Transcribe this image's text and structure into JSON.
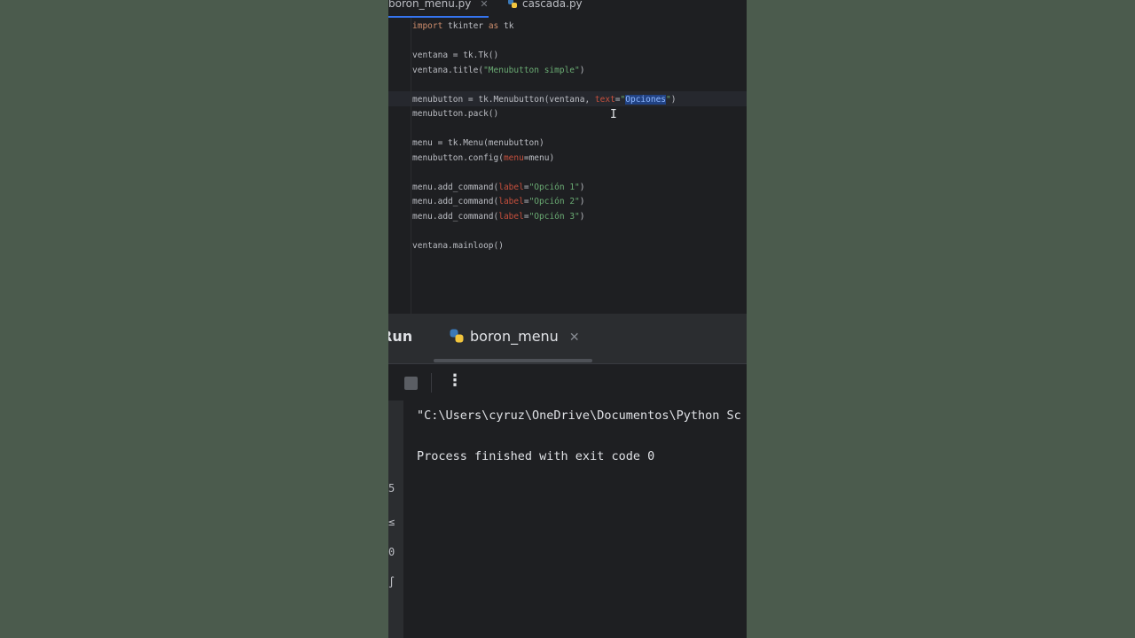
{
  "tabs": [
    {
      "label": "boron_menu.py",
      "active": true
    },
    {
      "label": "cascada.py",
      "active": false
    }
  ],
  "editor": {
    "lines": [
      [
        {
          "t": "import",
          "c": "kw"
        },
        {
          "t": " tkinter "
        },
        {
          "t": "as",
          "c": "kw"
        },
        {
          "t": " tk"
        }
      ],
      [],
      [
        {
          "t": "ventana = tk.Tk()"
        }
      ],
      [
        {
          "t": "ventana.title("
        },
        {
          "t": "\"Menubutton simple\"",
          "c": "str"
        },
        {
          "t": ")"
        }
      ],
      [],
      [
        {
          "t": "menubutton = tk.Menubutton(ventana, "
        },
        {
          "t": "text",
          "c": "prm"
        },
        {
          "t": "="
        },
        {
          "t": "\"",
          "c": "str"
        },
        {
          "t": "Opciones",
          "c": "sel"
        },
        {
          "t": "\"",
          "c": "str"
        },
        {
          "t": ")"
        }
      ],
      [
        {
          "t": "menubutton.pack()"
        }
      ],
      [],
      [
        {
          "t": "menu = tk.Menu(menubutton)"
        }
      ],
      [
        {
          "t": "menubutton.config("
        },
        {
          "t": "menu",
          "c": "prm"
        },
        {
          "t": "=menu)"
        }
      ],
      [],
      [
        {
          "t": "menu.add_command("
        },
        {
          "t": "label",
          "c": "prm"
        },
        {
          "t": "="
        },
        {
          "t": "\"Opción 1\"",
          "c": "str"
        },
        {
          "t": ")"
        }
      ],
      [
        {
          "t": "menu.add_command("
        },
        {
          "t": "label",
          "c": "prm"
        },
        {
          "t": "="
        },
        {
          "t": "\"Opción 2\"",
          "c": "str"
        },
        {
          "t": ")"
        }
      ],
      [
        {
          "t": "menu.add_command("
        },
        {
          "t": "label",
          "c": "prm"
        },
        {
          "t": "="
        },
        {
          "t": "\"Opción 3\"",
          "c": "str"
        },
        {
          "t": ")"
        }
      ],
      [],
      [
        {
          "t": "ventana.mainloop()"
        }
      ]
    ]
  },
  "run_panel": {
    "title": "Run",
    "tab_label": "boron_menu",
    "output": [
      "\"C:\\Users\\cyruz\\OneDrive\\Documentos\\Python Sc",
      "",
      "Process finished with exit code 0"
    ],
    "strip_icons": [
      "5",
      "≤",
      "0",
      "∫"
    ]
  },
  "colors": {
    "keyword": "#cf8e6d",
    "string": "#6aab73",
    "param": "#c7503d",
    "selection": "#214283",
    "accent": "#3574f0"
  }
}
